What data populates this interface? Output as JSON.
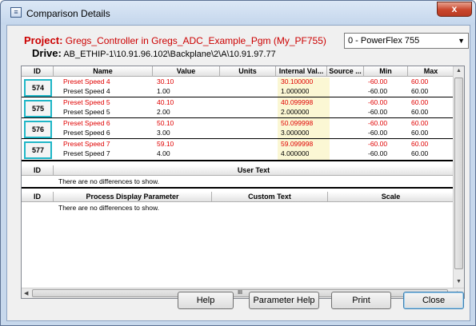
{
  "window": {
    "title": "Comparison Details",
    "close_label": "x"
  },
  "project": {
    "label": "Project:",
    "value": "Gregs_Controller in Gregs_ADC_Example_Pgm (My_PF755)"
  },
  "drive": {
    "label": "Drive:",
    "value": "AB_ETHIP-1\\10.91.96.102\\Backplane\\2\\A\\10.91.97.77"
  },
  "drive_select": {
    "value": "0 - PowerFlex 755"
  },
  "params_table": {
    "headers": [
      "ID",
      "Name",
      "Value",
      "Units",
      "Internal Val...",
      "Source ...",
      "Min",
      "Max"
    ],
    "groups": [
      {
        "id": "574",
        "rows": [
          {
            "name": "Preset Speed 4",
            "value": "30.10",
            "internal": "30.100000",
            "min": "-60.00",
            "max": "60.00"
          },
          {
            "name": "Preset Speed 4",
            "value": "1.00",
            "internal": "1.000000",
            "min": "-60.00",
            "max": "60.00"
          }
        ]
      },
      {
        "id": "575",
        "rows": [
          {
            "name": "Preset Speed 5",
            "value": "40.10",
            "internal": "40.099998",
            "min": "-60.00",
            "max": "60.00"
          },
          {
            "name": "Preset Speed 5",
            "value": "2.00",
            "internal": "2.000000",
            "min": "-60.00",
            "max": "60.00"
          }
        ]
      },
      {
        "id": "576",
        "rows": [
          {
            "name": "Preset Speed 6",
            "value": "50.10",
            "internal": "50.099998",
            "min": "-60.00",
            "max": "60.00"
          },
          {
            "name": "Preset Speed 6",
            "value": "3.00",
            "internal": "3.000000",
            "min": "-60.00",
            "max": "60.00"
          }
        ]
      },
      {
        "id": "577",
        "rows": [
          {
            "name": "Preset Speed 7",
            "value": "59.10",
            "internal": "59.099998",
            "min": "-60.00",
            "max": "60.00"
          },
          {
            "name": "Preset Speed 7",
            "value": "4.00",
            "internal": "4.000000",
            "min": "-60.00",
            "max": "60.00"
          }
        ]
      }
    ]
  },
  "user_text_table": {
    "headers": [
      "ID",
      "User Text"
    ],
    "empty_message": "There are no differences to show."
  },
  "process_table": {
    "headers": [
      "ID",
      "Process Display Parameter",
      "Custom Text",
      "Scale"
    ],
    "empty_message": "There are no differences to show."
  },
  "scrollbar": {
    "grip": "III"
  },
  "buttons": {
    "help": "Help",
    "parameter_help": "Parameter Help",
    "print": "Print",
    "close": "Close"
  },
  "colors": {
    "difference_text": "#e00000",
    "id_border": "#1fb6c7",
    "internal_highlight": "#fbf7d4"
  }
}
